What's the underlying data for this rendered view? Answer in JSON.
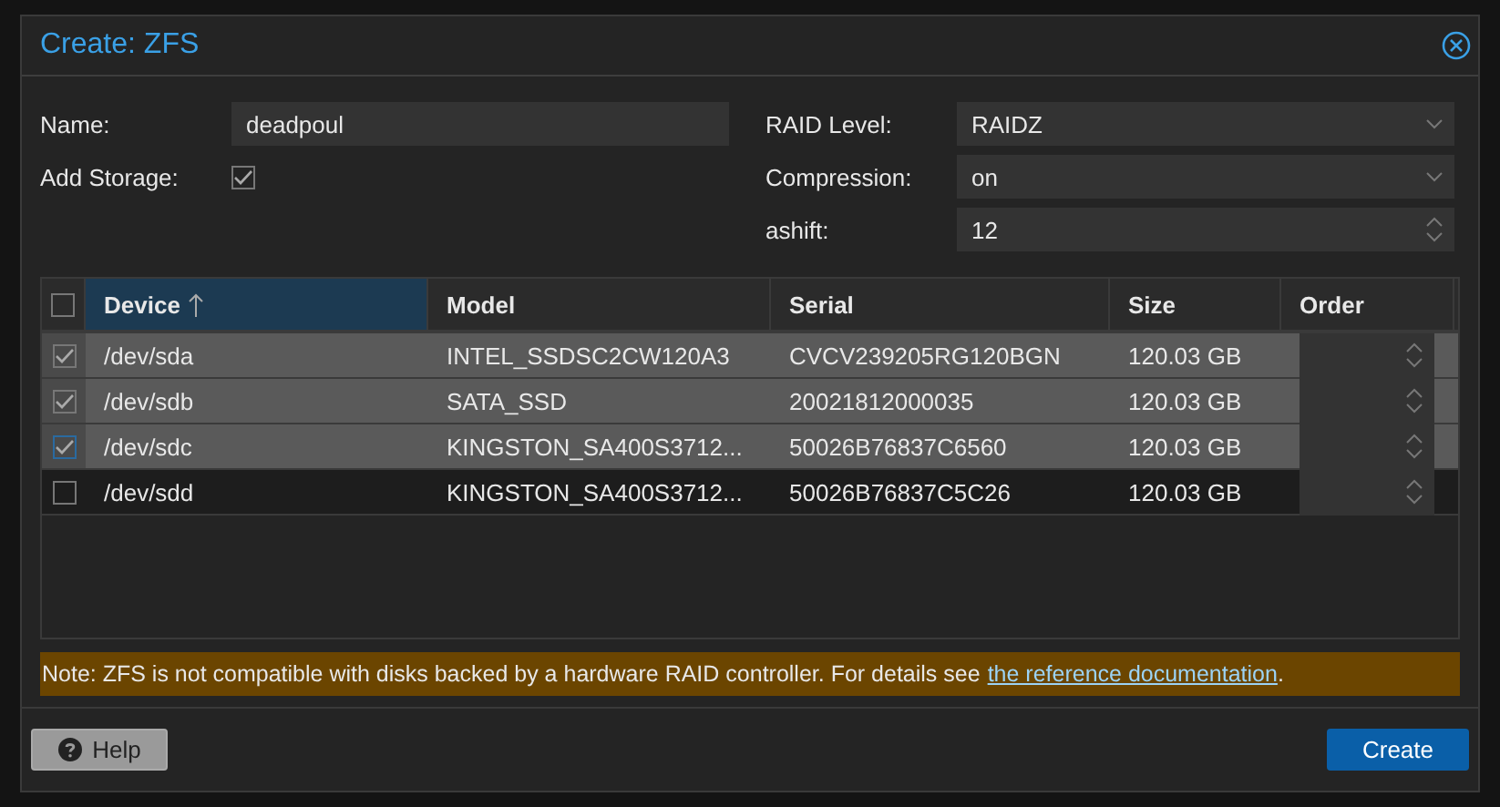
{
  "window": {
    "title": "Create: ZFS"
  },
  "form": {
    "left": [
      {
        "kind": "text",
        "label": "Name:",
        "value": "deadpoul"
      },
      {
        "kind": "checkbox",
        "label": "Add Storage:",
        "checked": true
      }
    ],
    "right": [
      {
        "kind": "select",
        "label": "RAID Level:",
        "value": "RAIDZ"
      },
      {
        "kind": "select",
        "label": "Compression:",
        "value": "on"
      },
      {
        "kind": "spinner",
        "label": "ashift:",
        "value": "12"
      }
    ]
  },
  "table": {
    "all_checked": false,
    "columns": [
      {
        "label": "Device",
        "sorted": true
      },
      {
        "label": "Model",
        "sorted": false
      },
      {
        "label": "Serial",
        "sorted": false
      },
      {
        "label": "Size",
        "sorted": false
      },
      {
        "label": "Order",
        "sorted": false
      }
    ],
    "rows": [
      {
        "selected": true,
        "device": "/dev/sda",
        "model": "INTEL_SSDSC2CW120A3",
        "serial": "CVCV239205RG120BGN",
        "size": "120.03 GB"
      },
      {
        "selected": true,
        "device": "/dev/sdb",
        "model": "SATA_SSD",
        "serial": "20021812000035",
        "size": "120.03 GB"
      },
      {
        "selected": true,
        "device": "/dev/sdc",
        "model": "KINGSTON_SA400S3712...",
        "serial": "50026B76837C6560",
        "size": "120.03 GB"
      },
      {
        "selected": false,
        "device": "/dev/sdd",
        "model": "KINGSTON_SA400S3712...",
        "serial": "50026B76837C5C26",
        "size": "120.03 GB"
      }
    ]
  },
  "note": {
    "text": "Note: ZFS is not compatible with disks backed by a hardware RAID controller. For details see",
    "link": "the reference documentation",
    "end": "."
  },
  "buttons": {
    "help": "Help",
    "create": "Create"
  }
}
